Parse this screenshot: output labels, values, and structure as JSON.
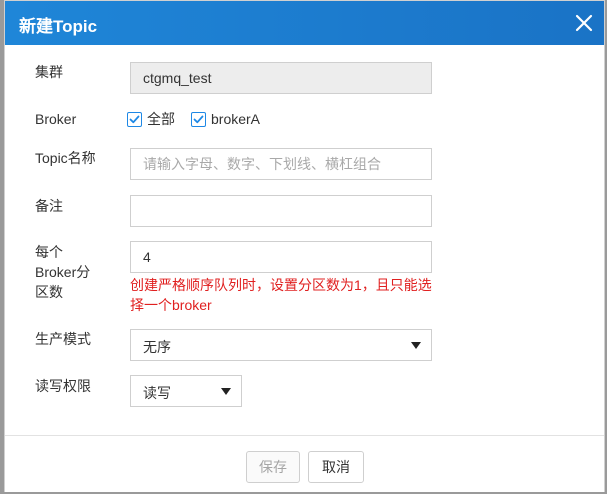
{
  "dialog": {
    "title": "新建Topic",
    "close_icon": "close-icon"
  },
  "form": {
    "cluster": {
      "label": "集群",
      "value": "ctgmq_test"
    },
    "broker": {
      "label": "Broker",
      "options": [
        {
          "label": "全部",
          "checked": true
        },
        {
          "label": "brokerA",
          "checked": true
        }
      ]
    },
    "topic_name": {
      "label": "Topic名称",
      "value": "",
      "placeholder": "请输入字母、数字、下划线、横杠组合"
    },
    "remark": {
      "label": "备注",
      "value": "",
      "placeholder": ""
    },
    "partitions": {
      "label_lines": [
        "每个",
        "Broker分",
        "区数"
      ],
      "value": "4",
      "hint_lines": [
        "创建严格顺序队列时，设置分区数为1，且只能选",
        "择一个broker"
      ]
    },
    "produce_mode": {
      "label": "生产模式",
      "selected": "无序"
    },
    "rw_permission": {
      "label": "读写权限",
      "selected": "读写"
    }
  },
  "footer": {
    "save_label": "保存",
    "cancel_label": "取消"
  },
  "colors": {
    "header_bg": "#1a73c6",
    "hint_red": "#e02020",
    "checkbox_blue": "#1e88e5"
  }
}
